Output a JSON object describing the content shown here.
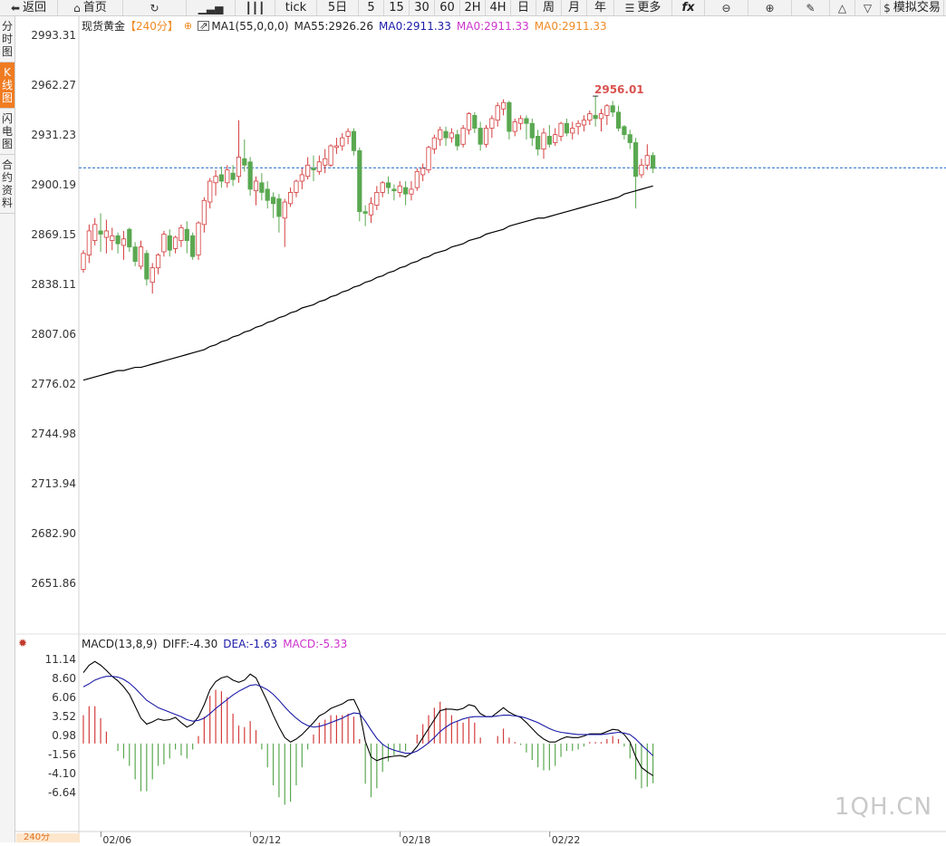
{
  "toolbar": [
    {
      "icon": "back-arrow-icon",
      "glyph": "⬅",
      "label": "返回",
      "w": 64
    },
    {
      "icon": "home-icon",
      "glyph": "⌂",
      "label": "首页",
      "w": 72
    },
    {
      "icon": "refresh-icon",
      "glyph": "↻",
      "label": "",
      "w": 70
    },
    {
      "icon": "bar-chart-icon",
      "glyph": "▁▃▅",
      "label": "",
      "w": 54
    },
    {
      "icon": "candle-icon",
      "glyph": "┃┃┃",
      "label": "",
      "w": 44
    },
    {
      "icon": "",
      "glyph": "",
      "label": "tick",
      "w": 46
    },
    {
      "icon": "",
      "glyph": "",
      "label": "5日",
      "w": 46
    },
    {
      "icon": "",
      "glyph": "",
      "label": "5",
      "w": 28
    },
    {
      "icon": "",
      "glyph": "",
      "label": "15",
      "w": 28
    },
    {
      "icon": "",
      "glyph": "",
      "label": "30",
      "w": 28
    },
    {
      "icon": "",
      "glyph": "",
      "label": "60",
      "w": 28
    },
    {
      "icon": "",
      "glyph": "",
      "label": "2H",
      "w": 28
    },
    {
      "icon": "",
      "glyph": "",
      "label": "4H",
      "w": 28
    },
    {
      "icon": "",
      "glyph": "",
      "label": "日",
      "w": 28
    },
    {
      "icon": "",
      "glyph": "",
      "label": "周",
      "w": 28
    },
    {
      "icon": "",
      "glyph": "",
      "label": "月",
      "w": 28
    },
    {
      "icon": "",
      "glyph": "",
      "label": "年",
      "w": 30
    },
    {
      "icon": "menu-icon",
      "glyph": "☰",
      "label": "更多",
      "w": 64
    },
    {
      "icon": "fx-icon",
      "glyph": "",
      "label": "fx",
      "w": 36
    },
    {
      "icon": "zoom-out-icon",
      "glyph": "⊖",
      "label": "",
      "w": 48
    },
    {
      "icon": "zoom-in-icon",
      "glyph": "⊕",
      "label": "",
      "w": 48
    },
    {
      "icon": "pen-icon",
      "glyph": "✎",
      "label": "",
      "w": 42
    },
    {
      "icon": "triangle-up-icon",
      "glyph": "△",
      "label": "",
      "w": 28
    },
    {
      "icon": "triangle-down-icon",
      "glyph": "▽",
      "label": "",
      "w": 28
    },
    {
      "icon": "dollar-icon",
      "glyph": "$",
      "label": "模拟交易",
      "w": 70
    }
  ],
  "sidebar": [
    {
      "label": "分时图",
      "active": false
    },
    {
      "label": "K线图",
      "active": true
    },
    {
      "label": "闪电图",
      "active": false
    },
    {
      "label": "合约资料",
      "active": false
    }
  ],
  "legend": {
    "symbol": "现货黄金",
    "period": "【240分】",
    "ma1": "MA1(55,0,0,0)",
    "ma55": "MA55:2926.26",
    "ma0a": "MA0:2911.33",
    "ma0b": "MA0:2911.33",
    "ma0c": "MA0:2911.33"
  },
  "max_label": "2956.01",
  "macd_legend": {
    "name": "MACD(13,8,9)",
    "diff": "DIFF:-4.30",
    "dea": "DEA:-1.63",
    "macd": "MACD:-5.33"
  },
  "price_ticks": [
    "2993.31",
    "2962.27",
    "2931.23",
    "2900.19",
    "2869.15",
    "2838.11",
    "2807.06",
    "2776.02",
    "2744.98",
    "2713.94",
    "2682.90",
    "2651.86"
  ],
  "macd_ticks": [
    "11.14",
    "8.60",
    "6.06",
    "3.52",
    "0.98",
    "-1.56",
    "-4.10",
    "-6.64"
  ],
  "x_labels": [
    "02/06",
    "02/12",
    "02/18",
    "02/22"
  ],
  "period_tag": "240分",
  "watermark": "1QH.CN",
  "current_price_line": 2911.33,
  "colors": {
    "up": "#d43c3c",
    "down": "#5aa851",
    "ma": "#000000",
    "dea": "#1a1aa8",
    "diff": "#000000",
    "macd": "#cc33cc",
    "ma0": "#f08a24",
    "grid_line": "#1a66cc"
  },
  "chart_data": {
    "type": "candlestick",
    "title": "现货黄金【240分】",
    "ylim": [
      2651.86,
      2993.31
    ],
    "candles": [
      [
        2848,
        2858,
        2846,
        2860
      ],
      [
        2857,
        2872,
        2852,
        2876
      ],
      [
        2866,
        2876,
        2863,
        2880
      ],
      [
        2872,
        2870,
        2859,
        2883
      ],
      [
        2868,
        2872,
        2858,
        2879
      ],
      [
        2866,
        2869,
        2860,
        2874
      ],
      [
        2869,
        2864,
        2858,
        2871
      ],
      [
        2863,
        2867,
        2854,
        2872
      ],
      [
        2873,
        2862,
        2859,
        2874
      ],
      [
        2862,
        2853,
        2850,
        2865
      ],
      [
        2850,
        2862,
        2848,
        2866
      ],
      [
        2858,
        2842,
        2838,
        2860
      ],
      [
        2840,
        2849,
        2833,
        2852
      ],
      [
        2849,
        2857,
        2845,
        2858
      ],
      [
        2859,
        2870,
        2856,
        2872
      ],
      [
        2869,
        2860,
        2856,
        2873
      ],
      [
        2861,
        2868,
        2858,
        2869
      ],
      [
        2866,
        2874,
        2862,
        2876
      ],
      [
        2873,
        2866,
        2858,
        2878
      ],
      [
        2869,
        2856,
        2854,
        2871
      ],
      [
        2857,
        2877,
        2854,
        2878
      ],
      [
        2876,
        2891,
        2871,
        2893
      ],
      [
        2890,
        2903,
        2886,
        2905
      ],
      [
        2902,
        2906,
        2894,
        2910
      ],
      [
        2907,
        2903,
        2899,
        2912
      ],
      [
        2902,
        2910,
        2899,
        2913
      ],
      [
        2908,
        2904,
        2900,
        2913
      ],
      [
        2906,
        2918,
        2902,
        2941
      ],
      [
        2917,
        2913,
        2909,
        2929
      ],
      [
        2915,
        2898,
        2894,
        2918
      ],
      [
        2897,
        2903,
        2888,
        2906
      ],
      [
        2902,
        2896,
        2891,
        2908
      ],
      [
        2898,
        2891,
        2886,
        2903
      ],
      [
        2893,
        2889,
        2880,
        2896
      ],
      [
        2892,
        2881,
        2871,
        2895
      ],
      [
        2880,
        2890,
        2862,
        2892
      ],
      [
        2889,
        2896,
        2887,
        2899
      ],
      [
        2896,
        2903,
        2893,
        2904
      ],
      [
        2903,
        2907,
        2898,
        2911
      ],
      [
        2906,
        2913,
        2904,
        2918
      ],
      [
        2911,
        2910,
        2903,
        2919
      ],
      [
        2909,
        2915,
        2907,
        2919
      ],
      [
        2913,
        2917,
        2908,
        2923
      ],
      [
        2913,
        2925,
        2912,
        2926
      ],
      [
        2924,
        2925,
        2920,
        2930
      ],
      [
        2925,
        2930,
        2922,
        2933
      ],
      [
        2931,
        2934,
        2926,
        2936
      ],
      [
        2934,
        2922,
        2919,
        2936
      ],
      [
        2922,
        2884,
        2878,
        2924
      ],
      [
        2884,
        2883,
        2875,
        2888
      ],
      [
        2882,
        2889,
        2877,
        2893
      ],
      [
        2888,
        2896,
        2885,
        2900
      ],
      [
        2896,
        2902,
        2893,
        2903
      ],
      [
        2902,
        2899,
        2895,
        2906
      ],
      [
        2898,
        2897,
        2891,
        2901
      ],
      [
        2896,
        2900,
        2893,
        2903
      ],
      [
        2899,
        2895,
        2888,
        2903
      ],
      [
        2895,
        2898,
        2891,
        2903
      ],
      [
        2899,
        2909,
        2897,
        2911
      ],
      [
        2907,
        2911,
        2903,
        2914
      ],
      [
        2910,
        2924,
        2908,
        2925
      ],
      [
        2923,
        2930,
        2920,
        2932
      ],
      [
        2929,
        2935,
        2925,
        2937
      ],
      [
        2934,
        2930,
        2925,
        2937
      ],
      [
        2930,
        2933,
        2927,
        2936
      ],
      [
        2932,
        2925,
        2922,
        2935
      ],
      [
        2926,
        2936,
        2924,
        2938
      ],
      [
        2935,
        2945,
        2932,
        2946
      ],
      [
        2944,
        2936,
        2933,
        2946
      ],
      [
        2936,
        2926,
        2922,
        2940
      ],
      [
        2926,
        2936,
        2924,
        2938
      ],
      [
        2936,
        2942,
        2930,
        2944
      ],
      [
        2941,
        2950,
        2937,
        2952
      ],
      [
        2948,
        2952,
        2944,
        2954
      ],
      [
        2952,
        2934,
        2929,
        2953
      ],
      [
        2934,
        2940,
        2931,
        2942
      ],
      [
        2939,
        2942,
        2935,
        2944
      ],
      [
        2942,
        2939,
        2929,
        2944
      ],
      [
        2939,
        2930,
        2925,
        2942
      ],
      [
        2931,
        2923,
        2919,
        2935
      ],
      [
        2923,
        2933,
        2917,
        2936
      ],
      [
        2931,
        2926,
        2924,
        2938
      ],
      [
        2927,
        2932,
        2925,
        2936
      ],
      [
        2931,
        2939,
        2928,
        2940
      ],
      [
        2939,
        2933,
        2931,
        2942
      ],
      [
        2933,
        2936,
        2929,
        2940
      ],
      [
        2937,
        2939,
        2932,
        2941
      ],
      [
        2938,
        2941,
        2934,
        2944
      ],
      [
        2941,
        2945,
        2938,
        2947
      ],
      [
        2944,
        2942,
        2937,
        2956
      ],
      [
        2942,
        2945,
        2934,
        2948
      ],
      [
        2944,
        2950,
        2938,
        2951
      ],
      [
        2950,
        2946,
        2943,
        2953
      ],
      [
        2946,
        2936,
        2934,
        2950
      ],
      [
        2937,
        2932,
        2929,
        2938
      ],
      [
        2932,
        2927,
        2923,
        2935
      ],
      [
        2927,
        2906,
        2886,
        2930
      ],
      [
        2907,
        2913,
        2905,
        2917
      ],
      [
        2913,
        2919,
        2910,
        2926
      ],
      [
        2919,
        2911,
        2908,
        2921
      ]
    ],
    "ma_line": [
      2779,
      2780,
      2781,
      2782,
      2783,
      2784,
      2785,
      2785,
      2786,
      2787,
      2787,
      2788,
      2789,
      2790,
      2791,
      2792,
      2793,
      2794,
      2795,
      2796,
      2797,
      2798,
      2800,
      2801,
      2803,
      2804,
      2806,
      2807,
      2809,
      2810,
      2812,
      2813,
      2815,
      2816,
      2818,
      2819,
      2821,
      2822,
      2824,
      2825,
      2826,
      2828,
      2829,
      2831,
      2832,
      2834,
      2835,
      2837,
      2838,
      2840,
      2841,
      2843,
      2844,
      2846,
      2847,
      2849,
      2850,
      2852,
      2853,
      2855,
      2856,
      2858,
      2859,
      2860,
      2862,
      2863,
      2864,
      2866,
      2867,
      2868,
      2870,
      2871,
      2872,
      2873,
      2875,
      2876,
      2877,
      2878,
      2879,
      2880,
      2880,
      2881,
      2882,
      2883,
      2884,
      2885,
      2886,
      2887,
      2888,
      2889,
      2890,
      2891,
      2892,
      2893,
      2895,
      2896,
      2897,
      2898,
      2899,
      2900
    ],
    "macd_ylim": [
      -9,
      12
    ],
    "diff": [
      9.5,
      10.5,
      11.0,
      10.5,
      9.8,
      9.0,
      8.4,
      7.6,
      6.6,
      5.0,
      3.4,
      2.6,
      2.9,
      3.3,
      3.1,
      3.2,
      3.5,
      2.8,
      2.2,
      2.6,
      3.6,
      5.2,
      7.2,
      8.3,
      8.8,
      9.0,
      8.5,
      8.2,
      8.5,
      9.3,
      8.8,
      7.2,
      5.6,
      3.8,
      2.2,
      0.8,
      0.2,
      0.6,
      1.2,
      2.0,
      2.8,
      3.7,
      4.1,
      4.7,
      5.0,
      5.3,
      5.8,
      5.9,
      4.3,
      0.3,
      -1.8,
      -2.3,
      -2.0,
      -1.8,
      -1.7,
      -1.6,
      -1.8,
      -1.3,
      -0.4,
      0.8,
      2.0,
      3.2,
      4.4,
      4.6,
      4.6,
      4.5,
      4.7,
      5.2,
      5.0,
      4.0,
      3.6,
      3.6,
      4.2,
      4.8,
      4.2,
      3.8,
      3.5,
      2.8,
      2.0,
      1.2,
      0.6,
      0.2,
      0.2,
      0.6,
      0.9,
      0.8,
      0.8,
      1.0,
      1.3,
      1.3,
      1.3,
      1.6,
      1.9,
      1.8,
      1.2,
      0.2,
      -1.8,
      -3.2,
      -3.8,
      -4.3
    ],
    "dea": [
      7.6,
      8.0,
      8.5,
      8.8,
      9.0,
      9.0,
      8.9,
      8.6,
      8.1,
      7.4,
      6.6,
      5.8,
      5.3,
      4.8,
      4.5,
      4.2,
      3.9,
      3.6,
      3.2,
      3.0,
      3.1,
      3.4,
      4.0,
      4.7,
      5.3,
      5.9,
      6.5,
      7.0,
      7.4,
      7.8,
      7.9,
      7.6,
      7.2,
      6.6,
      5.8,
      4.9,
      4.1,
      3.4,
      2.8,
      2.4,
      2.2,
      2.3,
      2.5,
      2.8,
      3.1,
      3.4,
      3.8,
      4.1,
      4.0,
      3.0,
      1.8,
      0.7,
      -0.1,
      -0.6,
      -0.9,
      -1.1,
      -1.3,
      -1.3,
      -1.0,
      -0.5,
      0.1,
      0.8,
      1.6,
      2.2,
      2.7,
      3.0,
      3.3,
      3.5,
      3.6,
      3.6,
      3.6,
      3.6,
      3.7,
      3.8,
      3.8,
      3.7,
      3.6,
      3.4,
      3.1,
      2.8,
      2.4,
      2.0,
      1.7,
      1.5,
      1.4,
      1.3,
      1.2,
      1.2,
      1.2,
      1.2,
      1.2,
      1.3,
      1.4,
      1.5,
      1.4,
      1.2,
      0.6,
      -0.2,
      -0.9,
      -1.63
    ],
    "macd": [
      3.8,
      5.0,
      5.0,
      3.4,
      1.6,
      0.0,
      -1.0,
      -2.0,
      -3.0,
      -4.8,
      -6.4,
      -6.4,
      -4.8,
      -3.0,
      -2.8,
      -2.0,
      -0.8,
      -1.6,
      -2.0,
      -0.8,
      1.0,
      3.6,
      6.4,
      7.2,
      7.0,
      6.2,
      4.0,
      2.4,
      2.2,
      3.0,
      1.8,
      -0.8,
      -3.2,
      -5.6,
      -7.2,
      -8.2,
      -7.8,
      -5.6,
      -3.2,
      -0.8,
      1.2,
      2.8,
      3.2,
      3.8,
      3.8,
      3.8,
      4.0,
      3.6,
      0.6,
      -5.4,
      -7.2,
      -6.0,
      -3.8,
      -2.4,
      -1.6,
      -1.0,
      -1.0,
      0.0,
      1.2,
      2.6,
      3.8,
      4.8,
      5.6,
      4.8,
      3.8,
      3.0,
      2.8,
      3.4,
      2.8,
      0.8,
      0.0,
      0.0,
      1.0,
      2.0,
      0.8,
      0.2,
      -0.2,
      -1.2,
      -2.2,
      -3.2,
      -3.6,
      -3.6,
      -3.0,
      -1.8,
      -1.0,
      -1.0,
      -0.8,
      -0.4,
      0.2,
      0.2,
      0.2,
      0.6,
      1.0,
      0.6,
      -0.4,
      -2.0,
      -4.8,
      -6.0,
      -5.8,
      -5.33
    ]
  }
}
